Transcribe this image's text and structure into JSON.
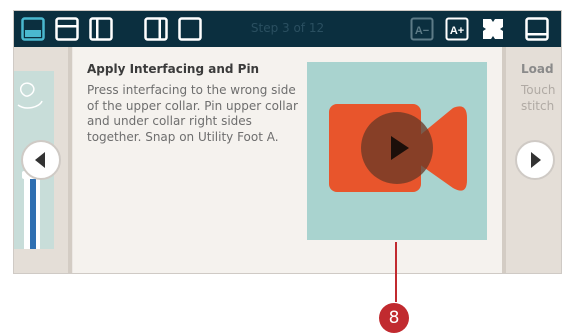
{
  "toolbar": {
    "step_label": "Step 3 of 12",
    "left_icons": [
      "layout-bottom-bar-icon",
      "layout-top-bar-icon",
      "layout-left-column-icon",
      "layout-right-column-icon",
      "layout-full-icon"
    ],
    "right_icons": [
      "text-smaller-icon",
      "text-larger-icon",
      "fullscreen-icon",
      "layout-bottom-panel-icon"
    ],
    "text_smaller": "A−",
    "text_larger": "A+"
  },
  "current_step": {
    "title": "Apply Interfacing and Pin",
    "body": "Press interfacing to the wrong side of the upper collar. Pin upper collar and under collar right sides together. Snap on Utility Foot A."
  },
  "next_step_preview": {
    "title": "Load",
    "body": "Touch\nstitch"
  },
  "callout": {
    "number": "8"
  },
  "colors": {
    "toolbar_bg": "#0b2f3f",
    "toolbar_icon": "#ffffff",
    "active_icon": "#4ab8cf",
    "video_bg": "#a9d3cf",
    "camera": "#e8552c",
    "callout": "#c12a2f"
  }
}
